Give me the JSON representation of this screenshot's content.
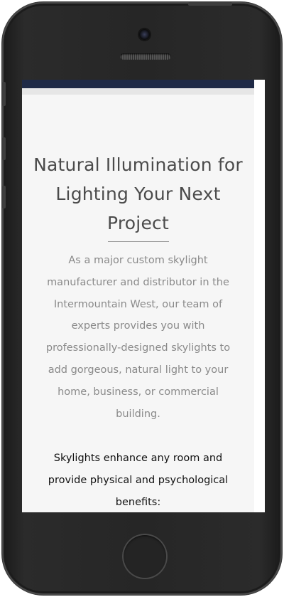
{
  "hero": {
    "heading": "Natural Illumination for Lighting Your Next Project",
    "intro": "As a major custom skylight manufacturer and distributor in the Intermountain West, our team of experts provides you with professionally-designed skylights to add gorgeous, natural light to your home, business, or commercial building.",
    "benefits_intro": "Skylights enhance any room and provide physical and psychological benefits:"
  },
  "colors": {
    "navbar": "#1f2a46",
    "heading": "#4b4b4b",
    "body_text": "#8a8a8a",
    "emphasis_text": "#111111",
    "content_bg": "#f6f6f6"
  },
  "device": {
    "camera_icon": "camera-icon",
    "home_icon": "home-button-icon"
  }
}
